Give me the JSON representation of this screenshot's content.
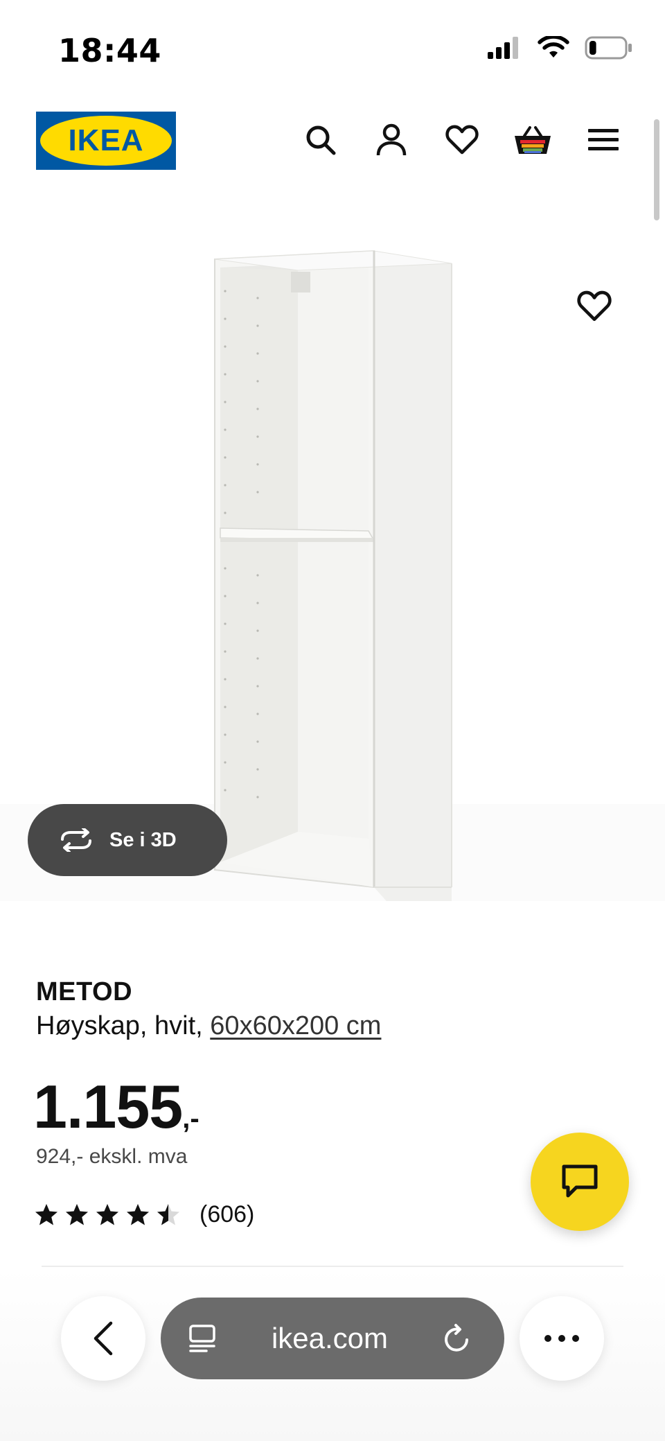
{
  "status_bar": {
    "time": "18:44",
    "icons": [
      "cellular-signal-icon",
      "wifi-icon",
      "battery-icon"
    ],
    "battery_level": 0.2
  },
  "header": {
    "logo_text": "IKEA",
    "icons": [
      "search-icon",
      "account-icon",
      "favorites-icon",
      "shopping-bag-icon",
      "menu-icon"
    ]
  },
  "product": {
    "name": "METOD",
    "description": "Høyskap, hvit, ",
    "size": "60x60x200 cm",
    "price_main": "1.155",
    "price_suffix": ",-",
    "price_ex_vat": "924,- ekskl. mva",
    "rating_value": 4.5,
    "rating_max": 5,
    "rating_count": "(606)",
    "view_3d_label": "Se i 3D"
  },
  "browser": {
    "url": "ikea.com"
  },
  "colors": {
    "ikea_blue": "#0058a3",
    "ikea_yellow": "#ffdb00",
    "chat_yellow": "#f6d51f",
    "pill_dark": "#484848",
    "url_pill": "#6b6b6b"
  }
}
